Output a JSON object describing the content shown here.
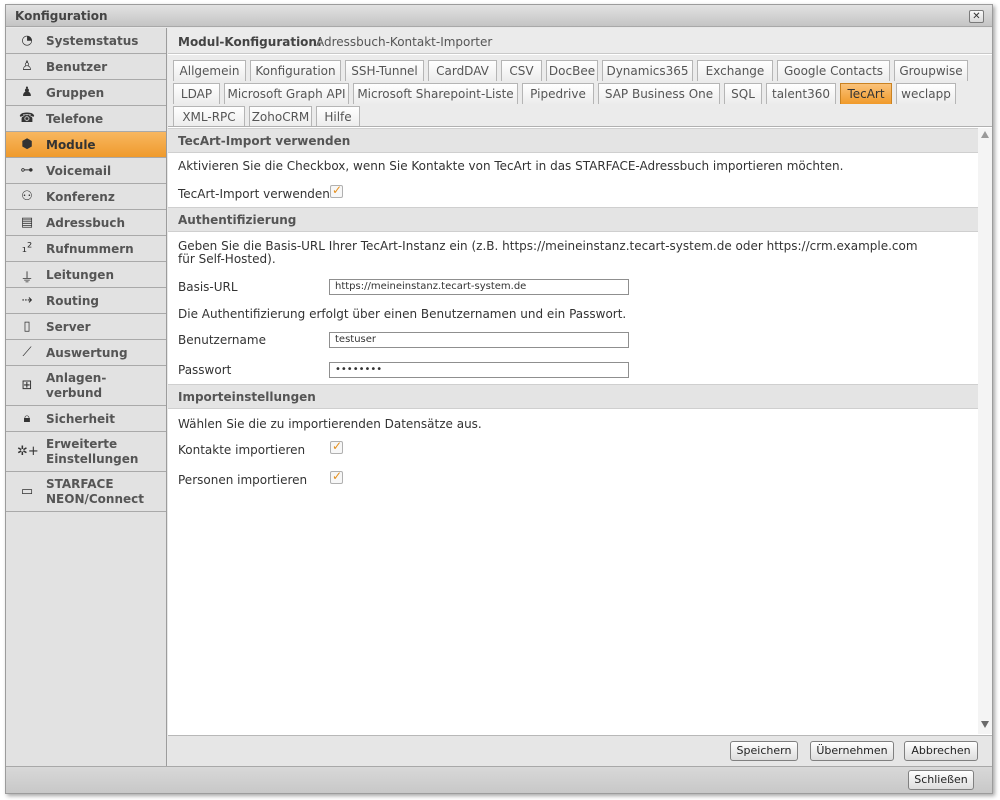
{
  "window": {
    "title": "Konfiguration",
    "close_symbol": "✕"
  },
  "sidebar": {
    "items": [
      {
        "label": "Systemstatus",
        "icon": "pie-chart-icon"
      },
      {
        "label": "Benutzer",
        "icon": "user-icon"
      },
      {
        "label": "Gruppen",
        "icon": "group-icon"
      },
      {
        "label": "Telefone",
        "icon": "phone-icon"
      },
      {
        "label": "Module",
        "icon": "cube-icon",
        "active": true
      },
      {
        "label": "Voicemail",
        "icon": "voicemail-icon"
      },
      {
        "label": "Konferenz",
        "icon": "conference-icon"
      },
      {
        "label": "Adressbuch",
        "icon": "addressbook-icon"
      },
      {
        "label": "Rufnummern",
        "icon": "numbers-icon"
      },
      {
        "label": "Leitungen",
        "icon": "plug-icon"
      },
      {
        "label": "Routing",
        "icon": "routing-icon"
      },
      {
        "label": "Server",
        "icon": "server-icon"
      },
      {
        "label": "Auswertung",
        "icon": "chart-icon"
      },
      {
        "label": "Anlagen-\nverbund",
        "icon": "network-icon"
      },
      {
        "label": "Sicherheit",
        "icon": "lock-icon"
      },
      {
        "label": "Erweiterte\nEinstellungen",
        "icon": "gears-icon"
      },
      {
        "label": "STARFACE\nNEON/Connect",
        "icon": "video-icon"
      }
    ]
  },
  "header": {
    "title": "Modul-Konfiguration:",
    "module_name": "Adressbuch-Kontakt-Importer"
  },
  "tabs": [
    [
      "Allgemein",
      "Konfiguration",
      "SSH-Tunnel",
      "CardDAV",
      "CSV",
      "DocBee",
      "Dynamics365",
      "Exchange",
      "Google Contacts",
      "Groupwise"
    ],
    [
      "LDAP",
      "Microsoft Graph API",
      "Microsoft Sharepoint-Liste",
      "Pipedrive",
      "SAP Business One",
      "SQL",
      "talent360",
      "TecArt",
      "weclapp"
    ],
    [
      "XML-RPC",
      "ZohoCRM",
      "Hilfe"
    ]
  ],
  "active_tab": "TecArt",
  "sections": {
    "import": {
      "title": "TecArt-Import verwenden",
      "description": "Aktivieren Sie die Checkbox, wenn Sie Kontakte von TecArt in das STARFACE-Adressbuch importieren möchten.",
      "checkbox_label": "TecArt-Import verwenden",
      "checked": true
    },
    "auth": {
      "title": "Authentifizierung",
      "description": "Geben Sie die Basis-URL Ihrer TecArt-Instanz ein (z.B. https://meineinstanz.tecart-system.de oder https://crm.example.com für Self-Hosted).",
      "url_label": "Basis-URL",
      "url_value": "https://meineinstanz.tecart-system.de",
      "auth_note": "Die Authentifizierung erfolgt über einen Benutzernamen und ein Passwort.",
      "username_label": "Benutzername",
      "username_value": "testuser",
      "password_label": "Passwort",
      "password_value": "••••••••"
    },
    "settings": {
      "title": "Importeinstellungen",
      "description": "Wählen Sie die zu importierenden Datensätze aus.",
      "contacts_label": "Kontakte importieren",
      "contacts_checked": true,
      "persons_label": "Personen importieren",
      "persons_checked": true
    }
  },
  "buttons": {
    "save": "Speichern",
    "apply": "Übernehmen",
    "cancel": "Abbrechen",
    "close": "Schließen"
  },
  "colors": {
    "accent": "#f0a030",
    "checkmark": "#e58f1c"
  }
}
